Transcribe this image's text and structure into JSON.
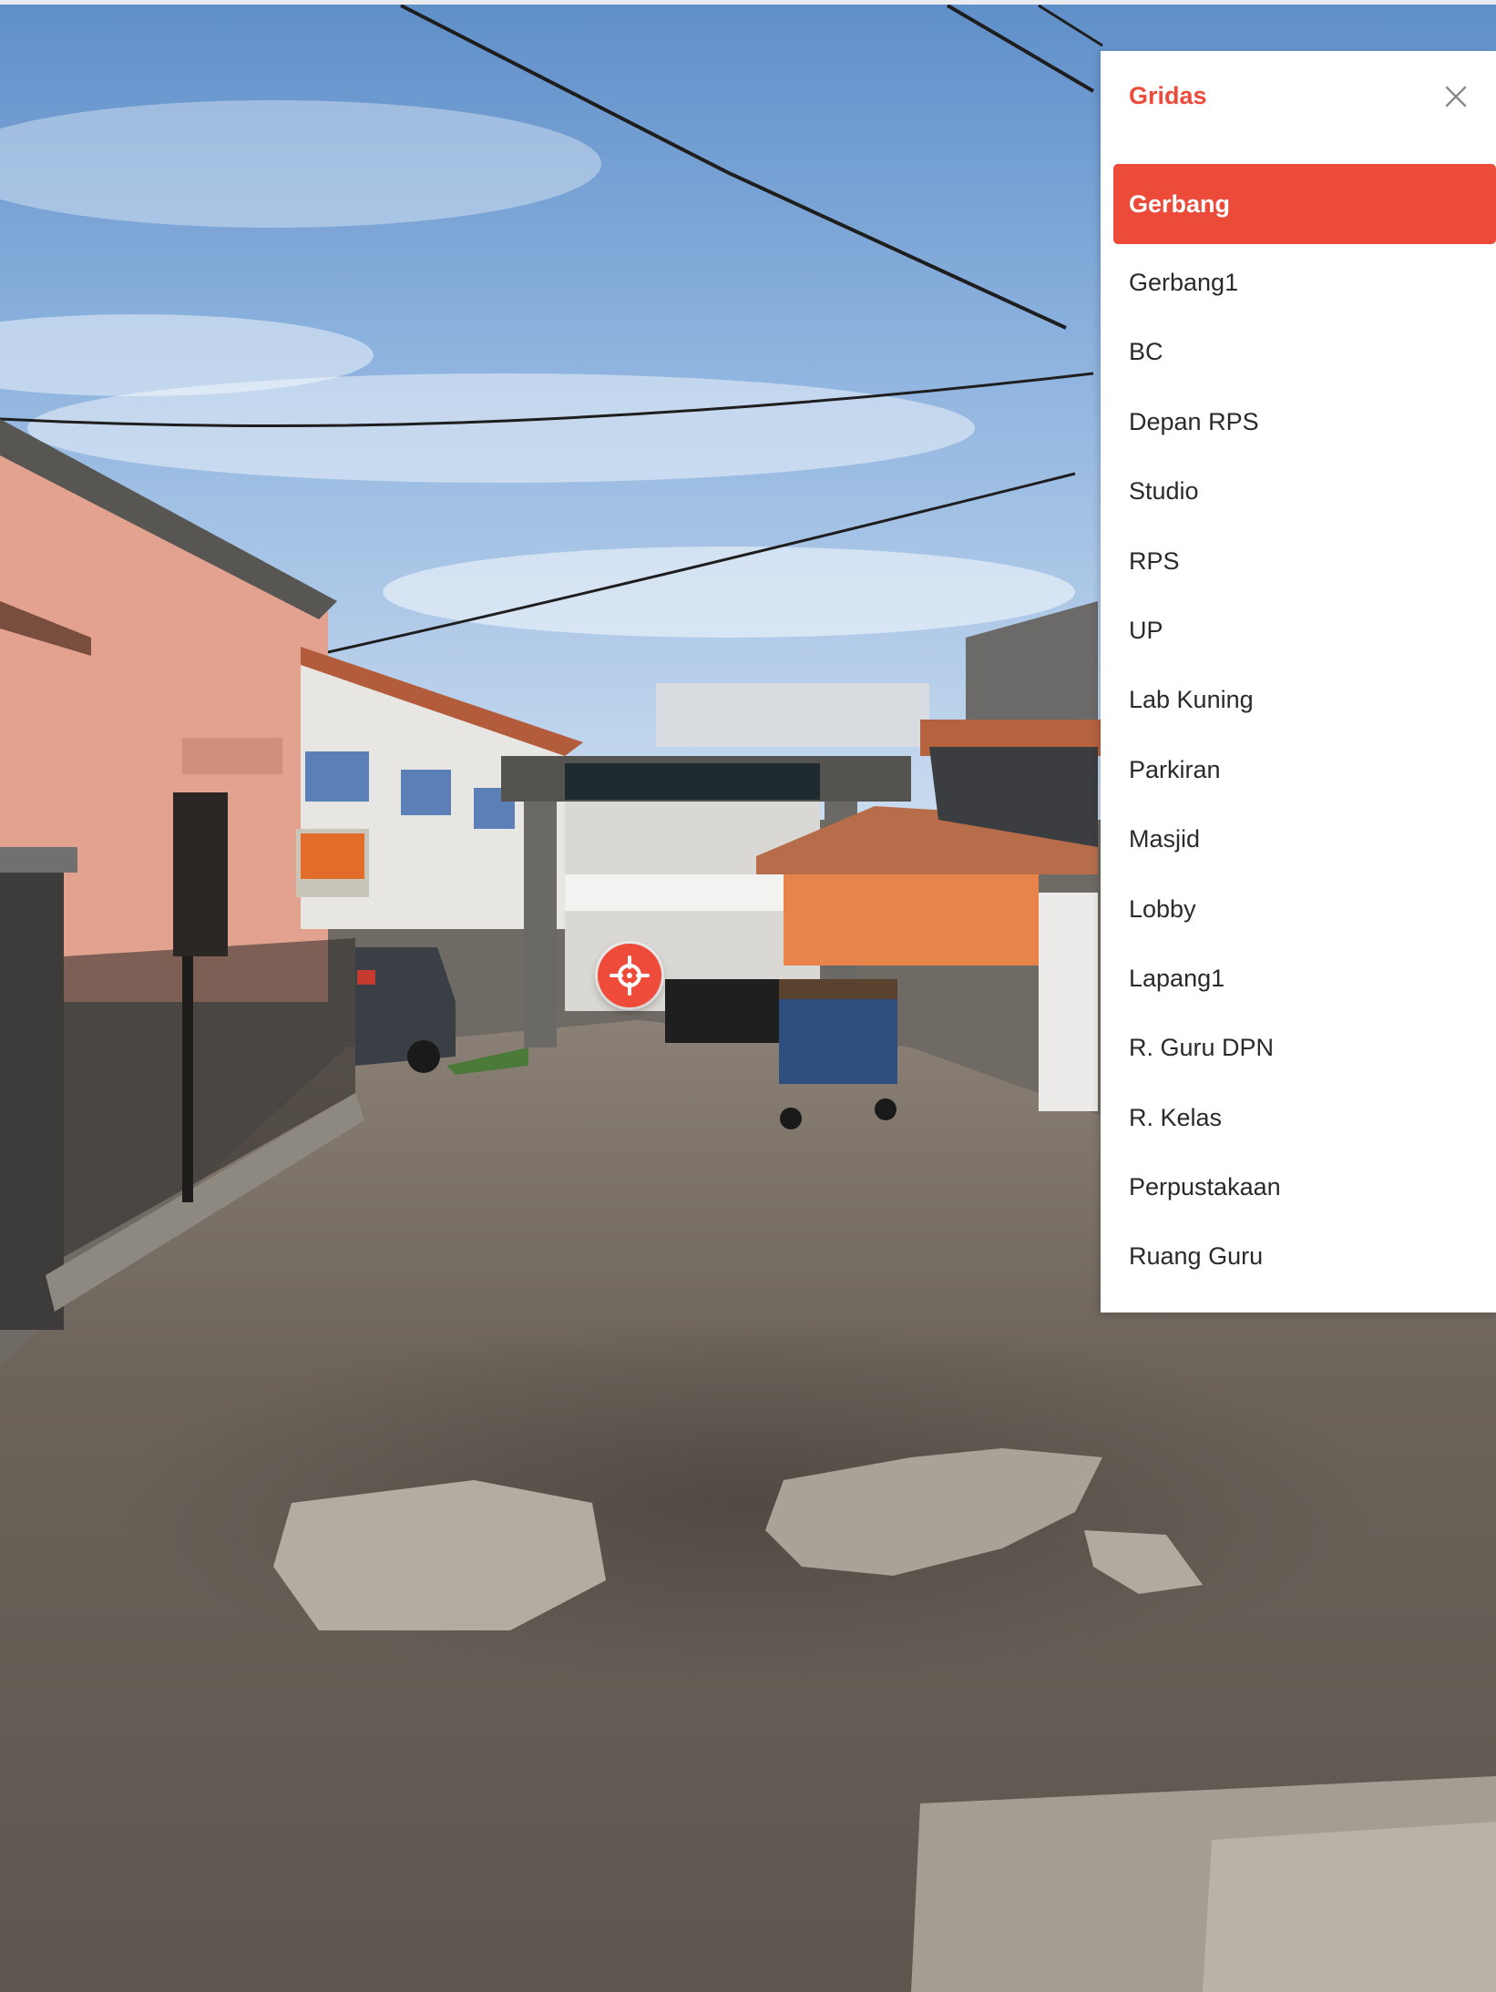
{
  "app": {
    "panel_title": "Gridas",
    "close_icon": "close-icon",
    "hotspot_icon": "crosshair-icon",
    "accent_color": "#ec4b3a"
  },
  "scenes": [
    {
      "label": "Gerbang",
      "active": true
    },
    {
      "label": "Gerbang1",
      "active": false
    },
    {
      "label": "BC",
      "active": false
    },
    {
      "label": "Depan RPS",
      "active": false
    },
    {
      "label": "Studio",
      "active": false
    },
    {
      "label": "RPS",
      "active": false
    },
    {
      "label": "UP",
      "active": false
    },
    {
      "label": "Lab Kuning",
      "active": false
    },
    {
      "label": "Parkiran",
      "active": false
    },
    {
      "label": "Masjid",
      "active": false
    },
    {
      "label": "Lobby",
      "active": false
    },
    {
      "label": "Lapang1",
      "active": false
    },
    {
      "label": "R. Guru DPN",
      "active": false
    },
    {
      "label": "R. Kelas",
      "active": false
    },
    {
      "label": "Perpustakaan",
      "active": false
    },
    {
      "label": "Ruang Guru",
      "active": false
    }
  ]
}
